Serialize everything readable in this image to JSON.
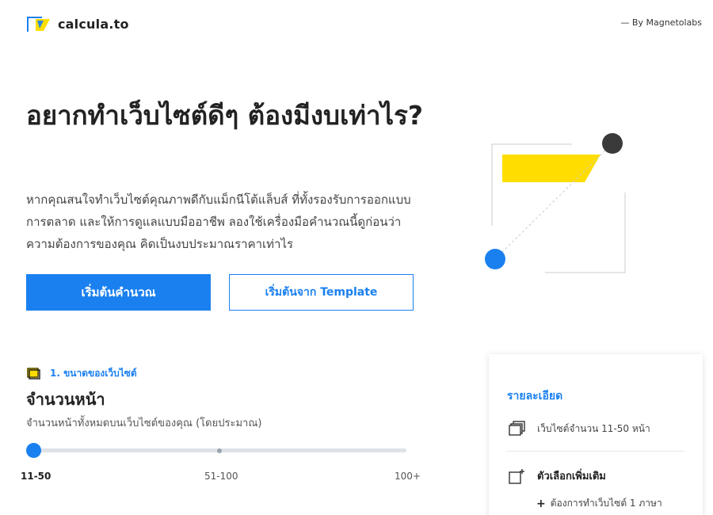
{
  "header": {
    "brand": "calcula.to",
    "byline": "— By Magnetolabs"
  },
  "hero": {
    "title": "อยากทำเว็บไซต์ดีๆ ต้องมีงบเท่าไร?",
    "description": "หากคุณสนใจทำเว็บไซต์คุณภาพดีกับแม็กนีโต้แล็บส์ ที่ทั้งรองรับการออกแบบ การตลาด และให้การดูแลแบบมืออาชีพ ลองใช้เครื่องมือคำนวณนี้ดูก่อนว่า ความต้องการของคุณ คิดเป็นงบประมาณราคาเท่าไร",
    "primary_button": "เริ่มต้นคำนวณ",
    "secondary_button": "เริ่มต้นจาก Template"
  },
  "step": {
    "label": "1. ขนาดของเว็บไซต์",
    "title": "จำนวนหน้า",
    "subtitle": "จำนวนหน้าทั้งหมดบนเว็บไซต์ของคุณ (โดยประมาณ)",
    "slider": {
      "options": [
        "11-50",
        "51-100",
        "100+"
      ],
      "selected": "11-50",
      "selected_index": 0
    }
  },
  "summary": {
    "title": "รายละเอียด",
    "pages_text": "เว็บไซต์จำนวน 11-50 หน้า",
    "extras_title": "ตัวเลือกเพิ่มเติม",
    "extras_item": "ต้องการทำเว็บไซต์ 1 ภาษา"
  },
  "colors": {
    "accent": "#1a80f0",
    "yellow": "#ffdd00",
    "dark": "#333333"
  },
  "icons": {
    "logo": "calcula-logo",
    "step": "pages-icon",
    "card_pages": "pages-stack-icon",
    "card_extras": "add-page-icon",
    "plus": "plus-icon"
  }
}
